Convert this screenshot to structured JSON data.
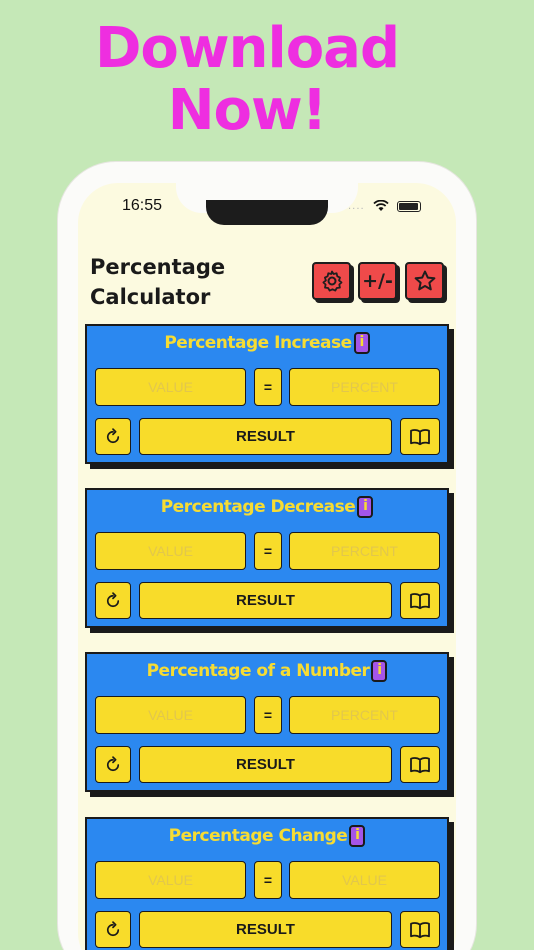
{
  "promo": {
    "line1": "Download",
    "line2": "Now!"
  },
  "status": {
    "time": "16:55",
    "signal": "....",
    "wifi": "wifi-icon",
    "battery": "battery-icon"
  },
  "app": {
    "title_line1": "Percentage",
    "title_line2": "Calculator"
  },
  "toolbar": {
    "settings_icon": "gear-icon",
    "plus_minus_label": "+/-",
    "favorites_icon": "star-icon"
  },
  "colors": {
    "accent": "#ee2ee0",
    "card": "#2b88f0",
    "field": "#f8dc2a",
    "button": "#ef4a4a",
    "info": "#a455e8"
  },
  "cards": [
    {
      "title": "Percentage Increase",
      "info": "i",
      "left_placeholder": "VALUE",
      "equals": "=",
      "right_placeholder": "PERCENT",
      "result": "RESULT"
    },
    {
      "title": "Percentage Decrease",
      "info": "i",
      "left_placeholder": "VALUE",
      "equals": "=",
      "right_placeholder": "PERCENT",
      "result": "RESULT"
    },
    {
      "title": "Percentage of a Number",
      "info": "i",
      "left_placeholder": "VALUE",
      "equals": "=",
      "right_placeholder": "PERCENT",
      "result": "RESULT"
    },
    {
      "title": "Percentage Change",
      "info": "i",
      "left_placeholder": "VALUE",
      "equals": "=",
      "right_placeholder": "VALUE",
      "result": "RESULT"
    }
  ]
}
